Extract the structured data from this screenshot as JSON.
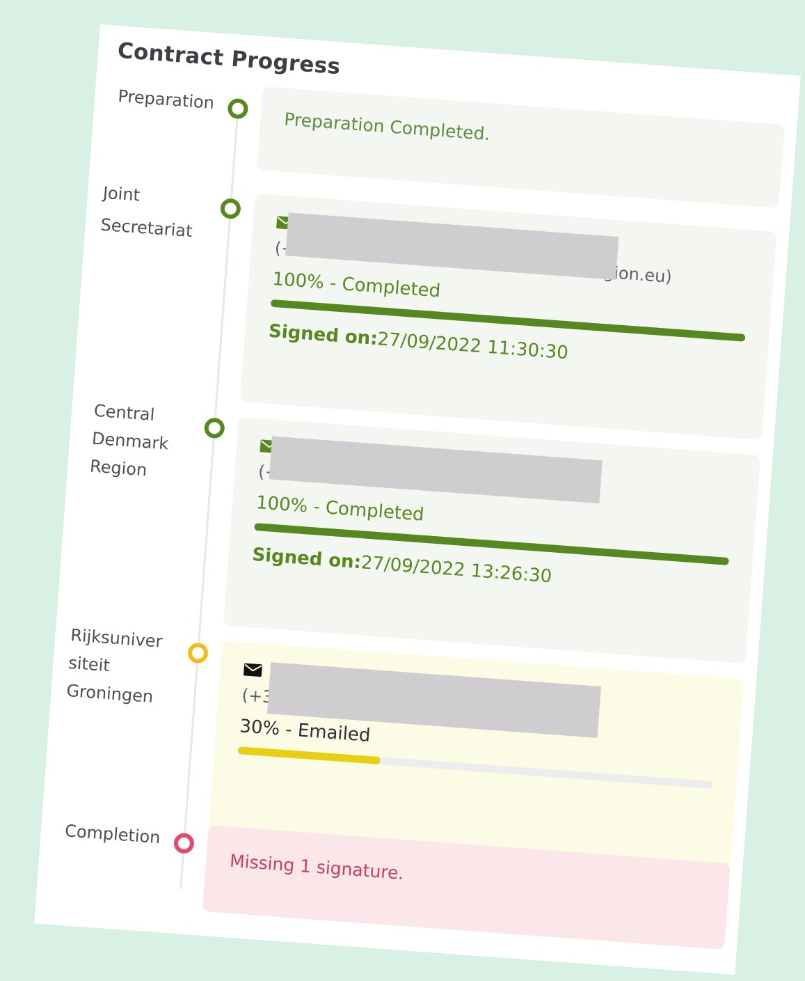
{
  "panel": {
    "title": "Contract Progress"
  },
  "colors": {
    "completed": "#55891f",
    "pending": "#f2bc1b",
    "pending_bar": "#e8cf12",
    "missing": "#e04a6e",
    "background": "#d9f1e4"
  },
  "steps": [
    {
      "label": "Preparation",
      "status": "completed",
      "message": "Preparation Completed."
    },
    {
      "label": "Joint Secretariat",
      "status": "completed",
      "contact_prefix": "(+4",
      "contact_suffix": "earegion.eu)",
      "progress_text": "100% - Completed",
      "progress": 100,
      "signed_label": "Signed on:",
      "signed_value": "27/09/2022 11:30:30"
    },
    {
      "label": "Central Denmark Region",
      "status": "completed",
      "contact_prefix": "(+4",
      "progress_text": "100% - Completed",
      "progress": 100,
      "signed_label": "Signed on:",
      "signed_value": "27/09/2022 13:26:30"
    },
    {
      "label": "Rijksuniversiteit Groningen",
      "label_lines": [
        "Rijksuniver",
        "siteit",
        "Groningen"
      ],
      "status": "emailed",
      "contact_prefix": "(+3",
      "progress_text": "30% - Emailed",
      "progress": 30
    },
    {
      "label": "Completion",
      "status": "missing",
      "message": "Missing 1 signature."
    }
  ]
}
